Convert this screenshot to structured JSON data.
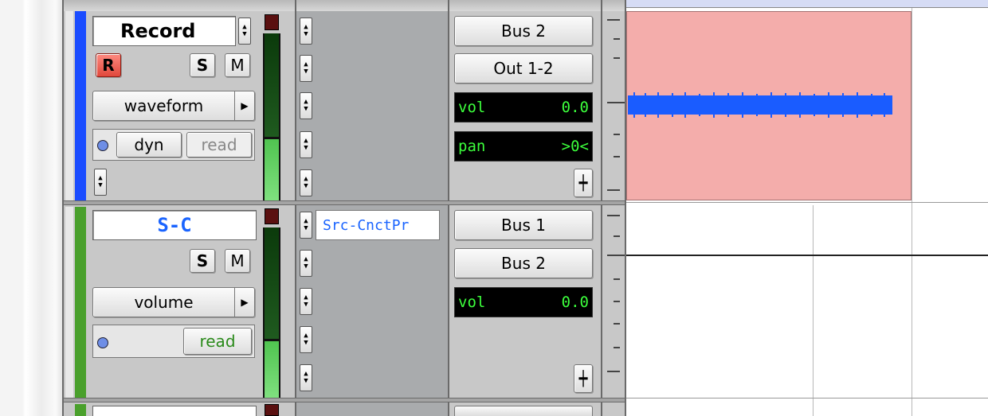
{
  "tracks": [
    {
      "name": "Record",
      "color": "#1a4cff",
      "record_label": "R",
      "solo_label": "S",
      "mute_label": "M",
      "view_label": "waveform",
      "dyn_label": "dyn",
      "automation_label": "read",
      "insert_label": "",
      "sends": [
        "Bus 2",
        "Out 1-2"
      ],
      "vol_label": "vol",
      "vol_value": "0.0",
      "pan_label": "pan",
      "pan_value": ">0<",
      "meter_level": 0.36
    },
    {
      "name": "S-C",
      "color": "#4aa02c",
      "solo_label": "S",
      "mute_label": "M",
      "view_label": "volume",
      "automation_label": "read",
      "insert_label": "Src-CnctPr",
      "sends": [
        "Bus 1",
        "Bus 2"
      ],
      "vol_label": "vol",
      "vol_value": "0.0",
      "meter_level": 0.34
    }
  ],
  "icons": {
    "stepper": "up-down-arrows",
    "popup": "right-triangle",
    "automation_dot": "blue-circle",
    "fader": "fader-icon"
  },
  "colors": {
    "region_fill": "#f4adab",
    "waveform": "#1a5cff",
    "lcd_text": "#3cff3c",
    "record_button": "#e0483c"
  }
}
